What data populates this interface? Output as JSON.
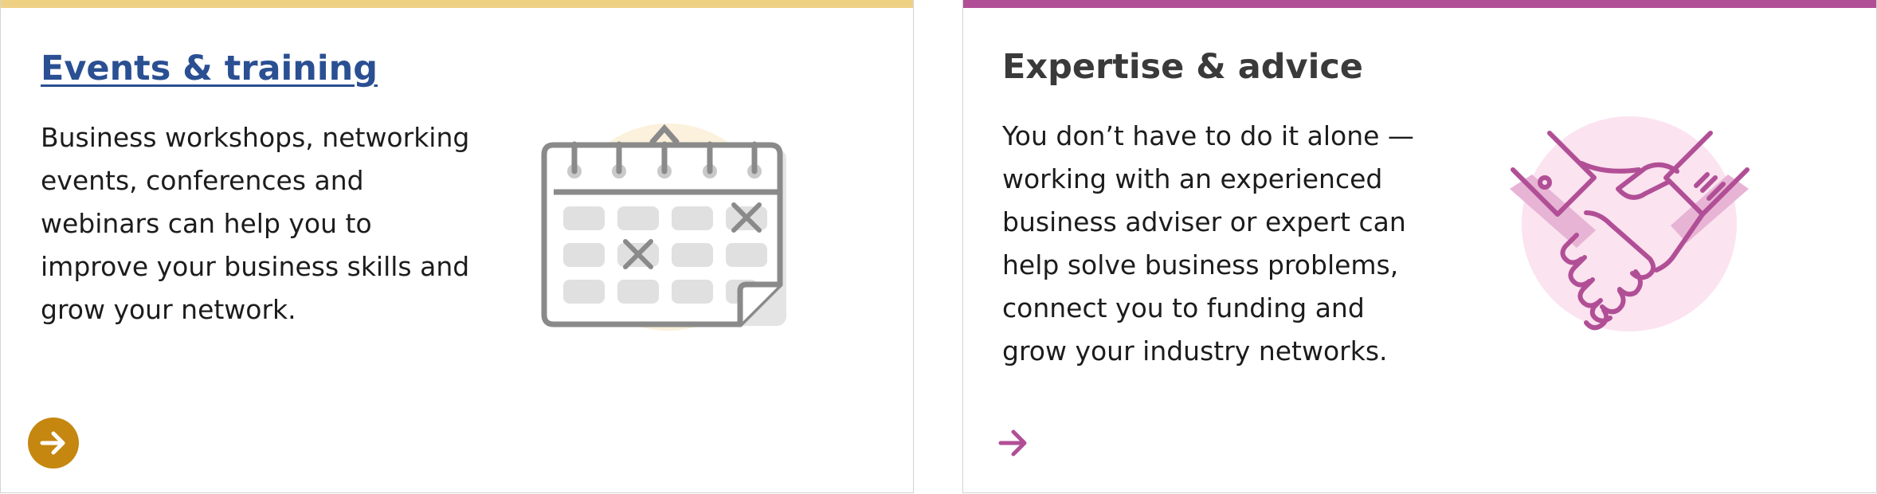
{
  "cards": [
    {
      "title": "Events & training",
      "description": "Business workshops, networking events, conferences and webinars can help you to improve your business skills and grow your network.",
      "accent_color": "#efd184",
      "button_color": "#c5870f",
      "icon": "calendar-icon",
      "action_icon": "arrow-right-icon"
    },
    {
      "title": "Expertise & advice",
      "description": "You don’t have to do it alone — working with an experienced business adviser or expert can help solve business problems, connect you to funding and grow your industry networks.",
      "accent_color": "#b14f96",
      "icon": "handshake-icon",
      "action_icon": "arrow-right-icon"
    }
  ]
}
